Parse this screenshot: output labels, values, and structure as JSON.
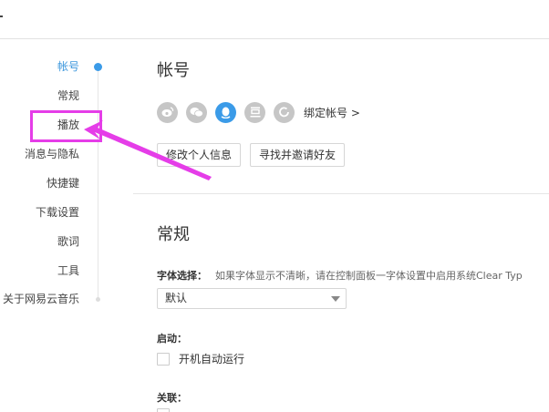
{
  "sidebar": {
    "items": [
      {
        "label": "帐号",
        "active": true
      },
      {
        "label": "常规"
      },
      {
        "label": "播放"
      },
      {
        "label": "消息与隐私"
      },
      {
        "label": "快捷键"
      },
      {
        "label": "下载设置"
      },
      {
        "label": "歌词"
      },
      {
        "label": "工具"
      },
      {
        "label": "关于网易云音乐"
      }
    ]
  },
  "account": {
    "title": "帐号",
    "social_icons": [
      "weibo-icon",
      "wechat-icon",
      "qq-icon",
      "douban-icon",
      "netease-icon"
    ],
    "bind_label": "绑定帐号",
    "bind_chevron": ">",
    "edit_profile_button": "修改个人信息",
    "invite_friends_button": "寻找并邀请好友"
  },
  "general": {
    "title": "常规",
    "font_label": "字体选择：",
    "font_hint": "如果字体显示不清晰，请在控制面板一字体设置中启用系统Clear Typ",
    "font_value": "默认",
    "startup_label": "启动：",
    "autostart_label": "开机自动运行",
    "association_label": "关联："
  },
  "colors": {
    "accent": "#3b9be8",
    "highlight": "#e53de8"
  }
}
